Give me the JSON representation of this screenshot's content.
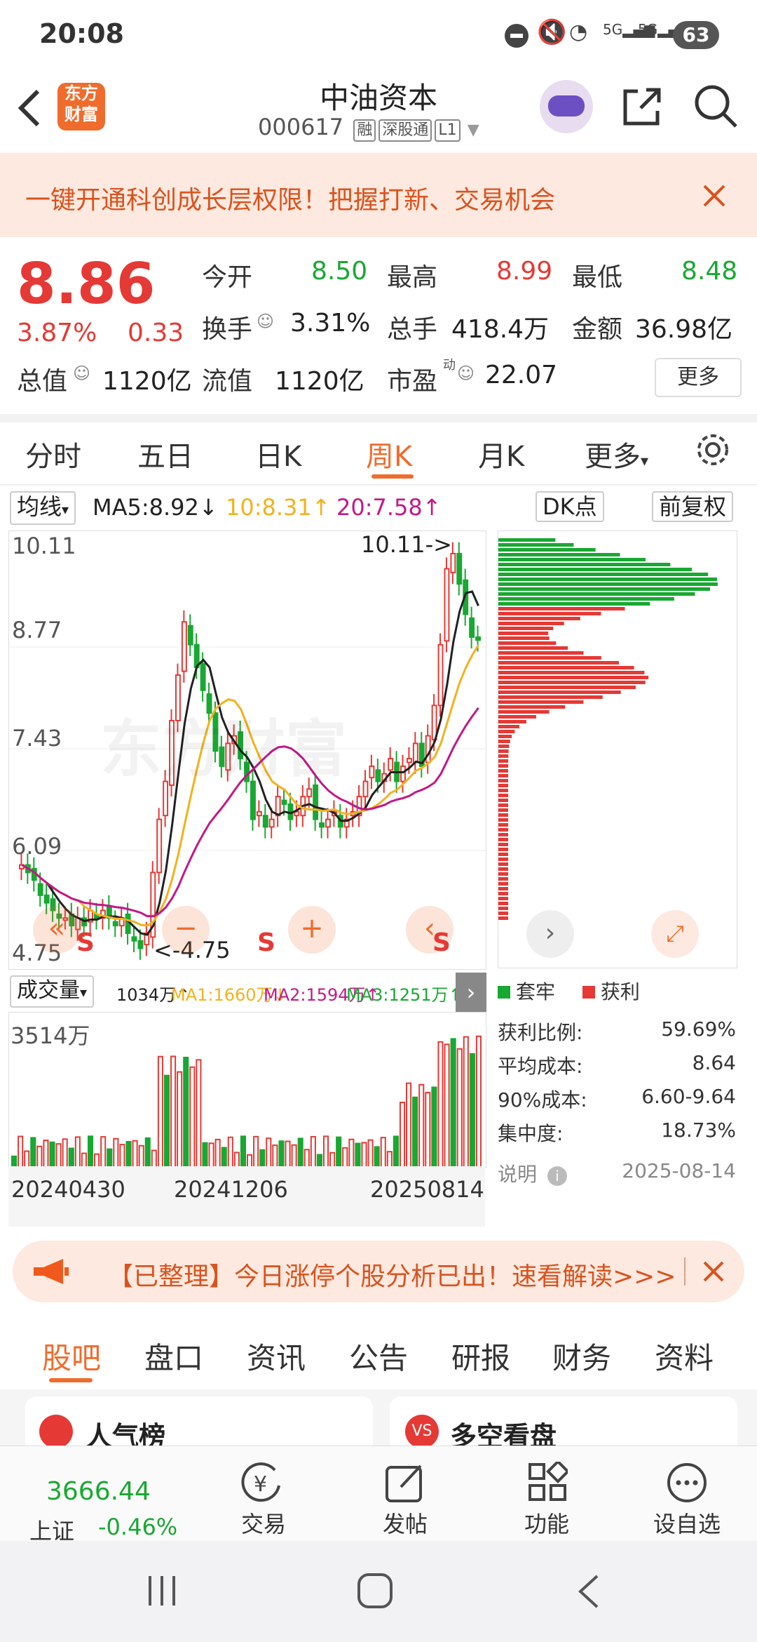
{
  "status_bar": {
    "time": "20:08",
    "battery": "63"
  },
  "header": {
    "logo_line1": "东方",
    "logo_line2": "财富",
    "title": "中油资本",
    "code": "000617",
    "tags": [
      "融",
      "深股通",
      "L1"
    ]
  },
  "banner": {
    "text": "一键开通科创成长层权限！把握打新、交易机会"
  },
  "quote": {
    "price": "8.86",
    "change_pct": "3.87%",
    "change": "0.33",
    "open_label": "今开",
    "open": "8.50",
    "high_label": "最高",
    "high": "8.99",
    "low_label": "最低",
    "low": "8.48",
    "turnover_label": "换手",
    "turnover": "3.31%",
    "volume_label": "总手",
    "volume": "418.4万",
    "amount_label": "金额",
    "amount": "36.98亿",
    "mktcap_label": "总值",
    "mktcap": "1120亿",
    "float_label": "流值",
    "float_cap": "1120亿",
    "pe_label": "市盈",
    "pe_sup": "动",
    "pe": "22.07",
    "more": "更多"
  },
  "tabs": [
    "分时",
    "五日",
    "日K",
    "周K",
    "月K",
    "更多"
  ],
  "active_tab": "周K",
  "ma_row": {
    "selector": "均线",
    "ma5": "MA5:8.92",
    "ma10": "10:8.31",
    "ma20": "20:7.58",
    "dk": "DK点",
    "adjust": "前复权"
  },
  "kline": {
    "y_labels": [
      "10.11",
      "8.77",
      "7.43",
      "6.09",
      "4.75"
    ],
    "max_note": "10.11->",
    "min_note": "<-4.75",
    "watermark": "东方财富",
    "s_marks": [
      "S",
      "S",
      "S"
    ]
  },
  "volume": {
    "selector": "成交量",
    "vol": "1034万",
    "ma1": "MA1:1660万",
    "ma2": "MA2:1594万",
    "ma3": "MA3:1251万",
    "max_label": "3514万",
    "dates": [
      "20240430",
      "20241206",
      "20250814"
    ]
  },
  "chips": {
    "legend_trap": "套牢",
    "legend_profit": "获利",
    "rows": [
      {
        "label": "获利比例:",
        "value": "59.69%"
      },
      {
        "label": "平均成本:",
        "value": "8.64"
      },
      {
        "label": "90%成本:",
        "value": "6.60-9.64"
      },
      {
        "label": "集中度:",
        "value": "18.73%"
      }
    ],
    "note_label": "说明",
    "date": "2025-08-14"
  },
  "promo": {
    "text": "【已整理】今日涨停个股分析已出！速看解读>>>"
  },
  "sub_tabs": [
    "股吧",
    "盘口",
    "资讯",
    "公告",
    "研报",
    "财务",
    "资料"
  ],
  "cards": [
    "人气榜",
    "多空看盘"
  ],
  "bottom": {
    "index_value": "3666.44",
    "index_name": "上证",
    "index_change": "-0.46%",
    "items": [
      "交易",
      "发帖",
      "功能",
      "设自选"
    ]
  },
  "colors": {
    "up": "#e53935",
    "down": "#19a832",
    "accent": "#ef6c2c",
    "ma5": "#222222",
    "ma10": "#f2b21c",
    "ma20": "#c2188a"
  }
}
